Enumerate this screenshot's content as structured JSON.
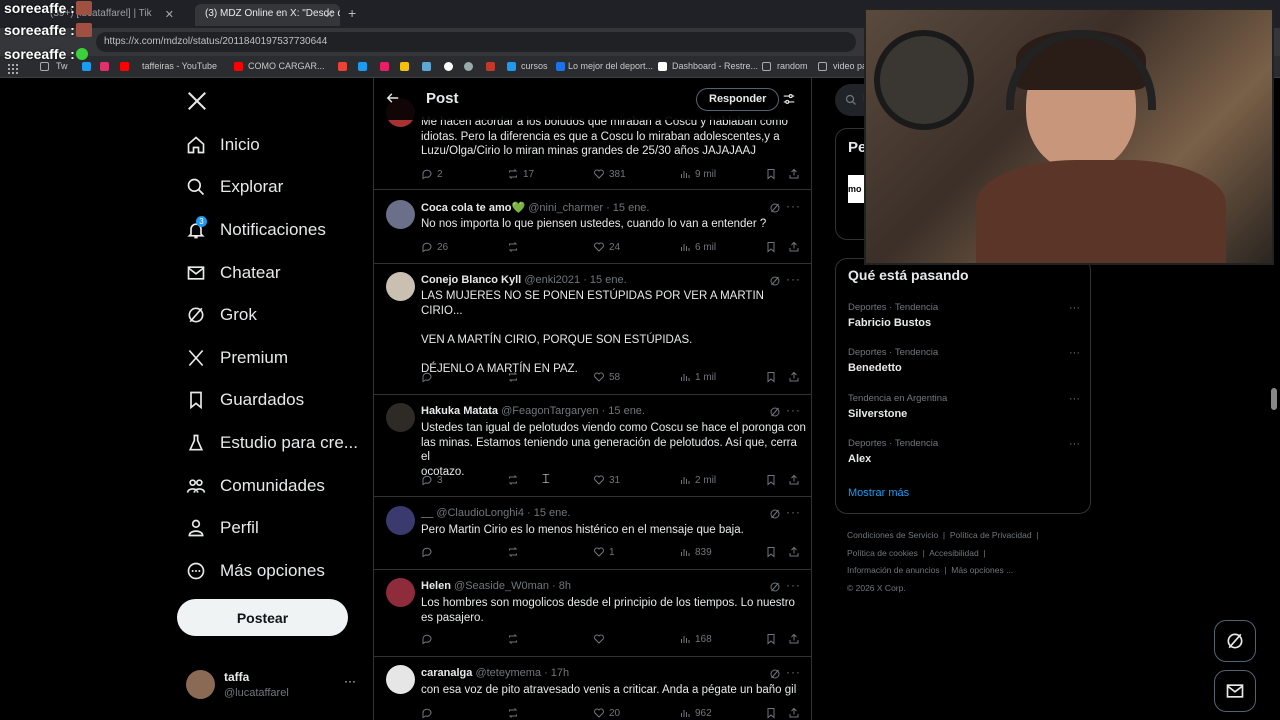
{
  "browser": {
    "tabs": [
      {
        "label": "(39+) [lucataffarel] | Tik"
      },
      {
        "label": "(3) MDZ Online en X: \"Desde q"
      }
    ],
    "new_tab": "+",
    "url": "https://x.com/mdzol/status/2011840197537730644",
    "bookmarks": [
      "Tw",
      "taffeiras - YouTube",
      "COMO CARGAR...",
      "cursos",
      "Lo mejor del deport...",
      "Dashboard - Restre...",
      "random",
      "video pa"
    ]
  },
  "stream_chat": [
    {
      "user": "soreeaffe :"
    },
    {
      "user": "soreeaffe :"
    },
    {
      "user": "soreeaffe :"
    }
  ],
  "nav": {
    "items": [
      {
        "label": "Inicio",
        "icon": "home-icon"
      },
      {
        "label": "Explorar",
        "icon": "search-icon"
      },
      {
        "label": "Notificaciones",
        "icon": "bell-icon",
        "badge": "3"
      },
      {
        "label": "Chatear",
        "icon": "mail-icon"
      },
      {
        "label": "Grok",
        "icon": "grok-icon"
      },
      {
        "label": "Premium",
        "icon": "x-logo-icon"
      },
      {
        "label": "Guardados",
        "icon": "bookmark-icon"
      },
      {
        "label": "Estudio para cre...",
        "icon": "flask-icon"
      },
      {
        "label": "Comunidades",
        "icon": "people-icon"
      },
      {
        "label": "Perfil",
        "icon": "person-icon"
      },
      {
        "label": "Más opciones",
        "icon": "more-circle-icon"
      }
    ],
    "post_button": "Postear",
    "user": {
      "name": "taffa",
      "handle": "@lucataffarel",
      "more": "···"
    }
  },
  "header": {
    "title": "Post",
    "reply_button": "Responder"
  },
  "tweets": [
    {
      "name": "",
      "handle": "",
      "time": "",
      "text": "Me hacen acordar a los boludos que miraban a Coscu y hablaban como\nidiotas. Pero la diferencia es que a Coscu lo miraban adolescentes,y a\nLuzu/Olga/Cirio lo miran minas grandes de 25/30 años JAJAJAAJ",
      "replies": "2",
      "reposts": "17",
      "likes": "381",
      "views": "9 mil"
    },
    {
      "name": "Coca cola te amo💚",
      "handle": "@nini_charmer",
      "time": "· 15 ene.",
      "text": "No nos importa lo que piensen ustedes, cuando lo van a entender ?",
      "replies": "26",
      "reposts": "",
      "likes": "24",
      "views": "6 mil"
    },
    {
      "name": "Conejo Blanco Kyll",
      "handle": "@enki2021",
      "time": "· 15 ene.",
      "text": "LAS MUJERES NO SE PONEN ESTÚPIDAS POR VER A MARTIN CIRIO...\n\nVEN A MARTÍN CIRIO, PORQUE SON ESTÚPIDAS.\n\nDÉJENLO A MARTÍN EN PAZ.",
      "replies": "",
      "reposts": "",
      "likes": "58",
      "views": "1 mil"
    },
    {
      "name": "Hakuka Matata",
      "handle": "@FeagonTargaryen",
      "time": "· 15 ene.",
      "text": "Ustedes tan igual de pelotudos viendo como Coscu se hace el poronga con\nlas minas. Estamos teniendo una generación de pelotudos. Así que, cerra el\nocotazo.",
      "replies": "3",
      "reposts": "",
      "likes": "31",
      "views": "2 mil"
    },
    {
      "name": "__",
      "handle": "@ClaudioLonghi4",
      "time": "· 15 ene.",
      "text": "Pero Martin Cirio es lo menos histérico en el mensaje que baja.",
      "replies": "",
      "reposts": "",
      "likes": "1",
      "views": "839"
    },
    {
      "name": "Helen",
      "handle": "@Seaside_W0man",
      "time": "· 8h",
      "text": "Los hombres son mogolicos desde el principio de los tiempos. Lo nuestro\nes pasajero.",
      "replies": "",
      "reposts": "",
      "likes": "",
      "views": "168"
    },
    {
      "name": "caranalga",
      "handle": "@teteymema",
      "time": "· 17h",
      "text": "con esa voz de pito atravesado venis a criticar. Anda a pégate un baño gil",
      "replies": "",
      "reposts": "",
      "likes": "20",
      "views": "962"
    }
  ],
  "right": {
    "search_placeholder": "Bu",
    "premium_title": "Pe",
    "premium_logo": "mo",
    "trends_title": "Qué está pasando",
    "trends": [
      {
        "category": "Deportes · Tendencia",
        "name": "Fabricio Bustos"
      },
      {
        "category": "Deportes · Tendencia",
        "name": "Benedetto"
      },
      {
        "category": "Tendencia en Argentina",
        "name": "Silverstone"
      },
      {
        "category": "Deportes · Tendencia",
        "name": "Alex"
      }
    ],
    "show_more": "Mostrar más",
    "footer": [
      "Condiciones de Servicio",
      "Política de Privacidad",
      "Política de cookies",
      "Accesibilidad",
      "Información de anuncios",
      "Más opciones ...",
      "© 2026 X Corp."
    ]
  },
  "colors": {
    "accent": "#1d9bf0",
    "background": "#000000",
    "border": "#2f3336",
    "muted": "#71767b"
  }
}
